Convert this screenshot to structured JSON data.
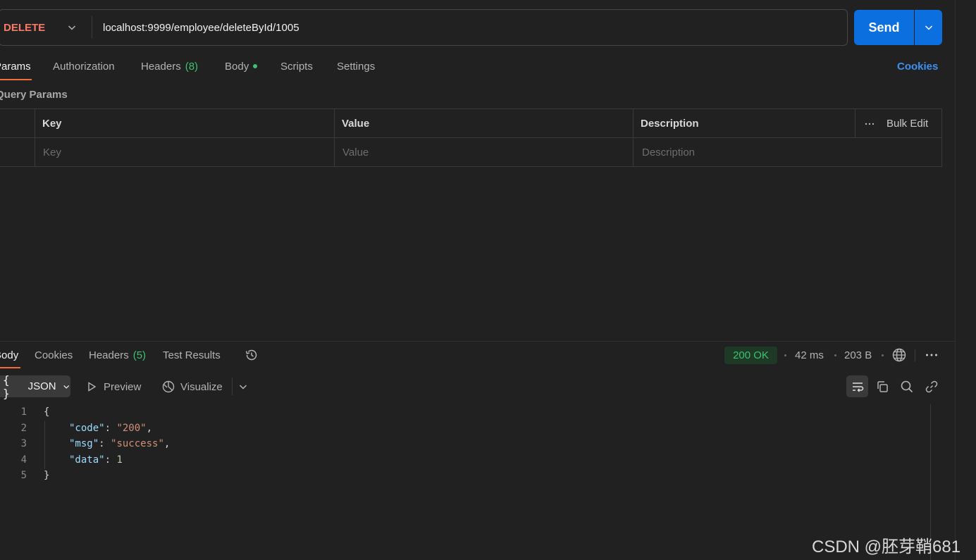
{
  "request": {
    "method": "DELETE",
    "url": "localhost:9999/employee/deleteById/1005",
    "send_label": "Send"
  },
  "request_tabs": {
    "params": "Params",
    "authorization": "Authorization",
    "headers": "Headers",
    "headers_count": "(8)",
    "body": "Body",
    "scripts": "Scripts",
    "settings": "Settings",
    "cookies": "Cookies"
  },
  "query_params": {
    "title": "Query Params",
    "columns": [
      "Key",
      "Value",
      "Description"
    ],
    "bulk_edit": "Bulk Edit",
    "placeholders": {
      "key": "Key",
      "value": "Value",
      "description": "Description"
    }
  },
  "response_tabs": {
    "body": "Body",
    "cookies": "Cookies",
    "headers": "Headers",
    "headers_count": "(5)",
    "test_results": "Test Results"
  },
  "response_meta": {
    "status": "200 OK",
    "time": "42 ms",
    "size": "203 B"
  },
  "format_bar": {
    "format": "JSON",
    "preview": "Preview",
    "visualize": "Visualize"
  },
  "response_body": {
    "line_numbers": [
      "1",
      "2",
      "3",
      "4",
      "5"
    ],
    "open_brace": "{",
    "close_brace": "}",
    "fields": [
      {
        "key": "\"code\"",
        "value": "\"200\"",
        "suffix": ",",
        "kind": "str"
      },
      {
        "key": "\"msg\"",
        "value": "\"success\"",
        "suffix": ",",
        "kind": "str"
      },
      {
        "key": "\"data\"",
        "value": "1",
        "suffix": "",
        "kind": "num"
      }
    ]
  },
  "watermark": "CSDN @胚芽鞘681",
  "colors": {
    "method": "#f77b67",
    "send": "#0c6fe0",
    "accent_tab": "#f26b3a",
    "status_ok": "#3cc271",
    "link": "#3c91f0"
  }
}
